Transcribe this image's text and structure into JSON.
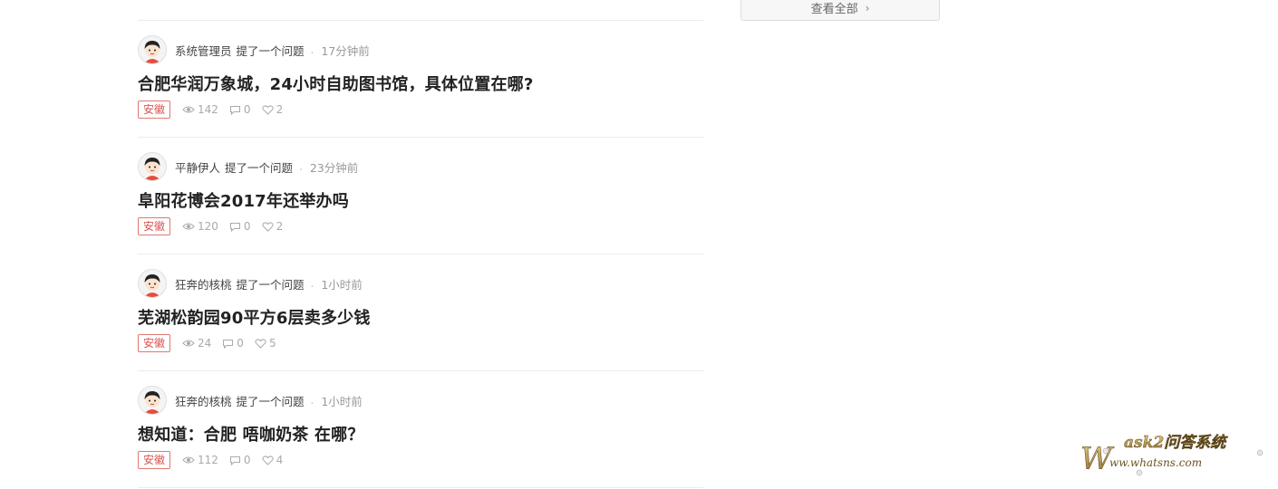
{
  "sidebar": {
    "view_all_label": "查看全部",
    "view_all_icon": "chevron-right-icon"
  },
  "feed": {
    "items": [
      {
        "author": "系统管理员",
        "action": "提了一个问题",
        "separator": ".",
        "time": "17分钟前",
        "title": "合肥华润万象城，24小时自助图书馆，具体位置在哪?",
        "tag": "安徽",
        "views": "142",
        "comments": "0",
        "likes": "2"
      },
      {
        "author": "平静伊人",
        "action": "提了一个问题",
        "separator": ".",
        "time": "23分钟前",
        "title": "阜阳花博会2017年还举办吗",
        "tag": "安徽",
        "views": "120",
        "comments": "0",
        "likes": "2"
      },
      {
        "author": "狂奔的核桃",
        "action": "提了一个问题",
        "separator": ".",
        "time": "1小时前",
        "title": "芜湖松韵园90平方6层卖多少钱",
        "tag": "安徽",
        "views": "24",
        "comments": "0",
        "likes": "5"
      },
      {
        "author": "狂奔的核桃",
        "action": "提了一个问题",
        "separator": ".",
        "time": "1小时前",
        "title": "想知道：合肥 唔咖奶茶 在哪？",
        "tag": "安徽",
        "views": "112",
        "comments": "0",
        "likes": "4"
      }
    ]
  },
  "watermark": {
    "brand": "ask2问答系统",
    "url": "Www.whatsns.com"
  },
  "colors": {
    "tag_border": "#e0786e",
    "tag_text": "#d9534f",
    "divider": "#ececec"
  }
}
